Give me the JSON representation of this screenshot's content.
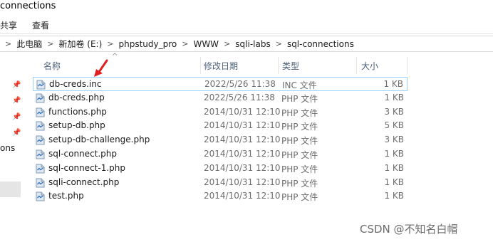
{
  "window": {
    "title": "connections"
  },
  "ribbon": {
    "tabs": [
      "共享",
      "查看"
    ]
  },
  "address": {
    "crumbs": [
      "此电脑",
      "新加卷 (E:)",
      "phpstudy_pro",
      "WWW",
      "sqli-labs",
      "sql-connections"
    ]
  },
  "nav": {
    "partial_label": "ons"
  },
  "columns": {
    "name": "名称",
    "date": "修改日期",
    "type": "类型",
    "size": "大小"
  },
  "files": [
    {
      "name": "db-creds.inc",
      "date": "2022/5/26 11:38",
      "type": "INC 文件",
      "size": "1 KB",
      "selected": true
    },
    {
      "name": "db-creds.php",
      "date": "2022/5/26 11:38",
      "type": "PHP 文件",
      "size": "1 KB"
    },
    {
      "name": "functions.php",
      "date": "2014/10/31 12:10",
      "type": "PHP 文件",
      "size": "3 KB"
    },
    {
      "name": "setup-db.php",
      "date": "2014/10/31 12:10",
      "type": "PHP 文件",
      "size": "5 KB"
    },
    {
      "name": "setup-db-challenge.php",
      "date": "2014/10/31 12:10",
      "type": "PHP 文件",
      "size": "3 KB"
    },
    {
      "name": "sql-connect.php",
      "date": "2014/10/31 12:10",
      "type": "PHP 文件",
      "size": "1 KB"
    },
    {
      "name": "sql-connect-1.php",
      "date": "2014/10/31 12:10",
      "type": "PHP 文件",
      "size": "1 KB"
    },
    {
      "name": "sqli-connect.php",
      "date": "2014/10/31 12:10",
      "type": "PHP 文件",
      "size": "1 KB"
    },
    {
      "name": "test.php",
      "date": "2014/10/31 12:10",
      "type": "PHP 文件",
      "size": "1 KB"
    }
  ],
  "watermark": "CSDN @不知名白帽",
  "colors": {
    "annotation_arrow": "#e02020",
    "selection_border": "#99d1ff",
    "header_text": "#4c607a"
  }
}
